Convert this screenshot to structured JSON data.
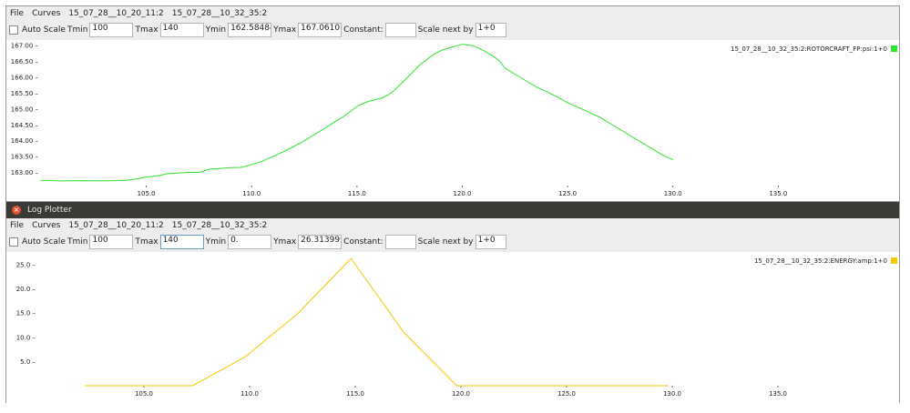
{
  "windows": [
    {
      "title": "",
      "menu": {
        "file": "File",
        "curves": "Curves",
        "sources": [
          "15_07_28__10_20_11:2",
          "15_07_28__10_32_35:2"
        ]
      },
      "toolbar": {
        "autoscale_label": "Auto Scale",
        "autoscale_checked": false,
        "tmin_label": "Tmin",
        "tmin_value": "100",
        "tmax_label": "Tmax",
        "tmax_value": "140",
        "ymin_label": "Ymin",
        "ymin_value": "162.58484",
        "ymax_label": "Ymax",
        "ymax_value": "167.06107",
        "constant_label": "Constant:",
        "constant_value": "",
        "scale_label": "Scale next by",
        "scale_value": "1+0"
      }
    },
    {
      "title": "Log Plotter",
      "menu": {
        "file": "File",
        "curves": "Curves",
        "sources": [
          "15_07_28__10_20_11:2",
          "15_07_28__10_32_35:2"
        ]
      },
      "toolbar": {
        "autoscale_label": "Auto Scale",
        "autoscale_checked": false,
        "tmin_label": "Tmin",
        "tmin_value": "100",
        "tmax_label": "Tmax",
        "tmax_value": "140",
        "ymin_label": "Ymin",
        "ymin_value": "0.",
        "ymax_label": "Ymax",
        "ymax_value": "26.313999",
        "constant_label": "Constant:",
        "constant_value": "",
        "scale_label": "Scale next by",
        "scale_value": "1+0"
      }
    }
  ],
  "chart_data": [
    {
      "type": "line",
      "xlim": [
        100,
        140
      ],
      "ylim": [
        162.58484,
        167.06107
      ],
      "xticks": [
        105.0,
        110.0,
        115.0,
        120.0,
        125.0,
        130.0,
        135.0
      ],
      "xtick_labels": [
        "105.0",
        "110.0",
        "115.0",
        "120.0",
        "125.0",
        "130.0",
        "135.0"
      ],
      "yticks": [
        163.0,
        163.5,
        164.0,
        164.5,
        165.0,
        165.5,
        166.0,
        166.5,
        167.0
      ],
      "ytick_labels": [
        "163.00 –",
        "163.50 –",
        "164.00 –",
        "164.50 –",
        "165.00 –",
        "165.50 –",
        "166.00 –",
        "166.50 –",
        "167.00 –"
      ],
      "series": [
        {
          "name": "15_07_28__10_32_35:2:ROTORCRAFT_FP:psi:1+0",
          "color": "#2ee32e",
          "x": [
            100.0,
            101.0,
            102.0,
            103.0,
            104.0,
            104.6,
            105.0,
            105.6,
            106.0,
            106.5,
            107.0,
            107.5,
            108.0,
            108.5,
            109.0,
            109.5,
            110.0,
            110.5,
            111.0,
            111.5,
            112.0,
            112.5,
            113.0,
            113.5,
            114.0,
            114.5,
            115.0,
            115.3,
            115.6,
            115.9,
            116.2,
            116.5,
            116.8,
            117.1,
            117.4,
            117.7,
            118.0,
            118.3,
            118.6,
            119.0,
            119.5,
            120.0,
            120.5,
            121.0,
            121.5,
            121.8,
            122.0,
            122.5,
            123.0,
            123.5,
            124.0,
            124.5,
            125.0,
            125.5,
            126.0,
            126.5,
            127.0,
            127.5,
            128.0,
            128.5,
            129.0,
            129.5,
            130.0
          ],
          "y": [
            162.75,
            162.73,
            162.74,
            162.73,
            162.75,
            162.8,
            162.85,
            162.9,
            162.96,
            162.98,
            163.0,
            163.0,
            163.1,
            163.12,
            163.15,
            163.16,
            163.25,
            163.35,
            163.5,
            163.65,
            163.82,
            164.0,
            164.2,
            164.4,
            164.62,
            164.82,
            165.08,
            165.18,
            165.25,
            165.3,
            165.35,
            165.45,
            165.6,
            165.8,
            166.0,
            166.2,
            166.4,
            166.55,
            166.7,
            166.85,
            166.95,
            167.04,
            167.0,
            166.85,
            166.65,
            166.5,
            166.3,
            166.1,
            165.9,
            165.7,
            165.55,
            165.38,
            165.2,
            165.05,
            164.9,
            164.75,
            164.55,
            164.35,
            164.15,
            163.95,
            163.75,
            163.55,
            163.4
          ]
        }
      ]
    },
    {
      "type": "line",
      "xlim": [
        100,
        140
      ],
      "ylim": [
        0,
        26.313999
      ],
      "xticks": [
        105.0,
        110.0,
        115.0,
        120.0,
        125.0,
        130.0,
        135.0
      ],
      "xtick_labels": [
        "105.0",
        "110.0",
        "115.0",
        "120.0",
        "125.0",
        "130.0",
        "135.0"
      ],
      "yticks": [
        5.0,
        10.0,
        15.0,
        20.0,
        25.0
      ],
      "ytick_labels": [
        "5.0 –",
        "10.0 –",
        "15.0 –",
        "20.0 –",
        "25.0 –"
      ],
      "series": [
        {
          "name": "15_07_28__10_32_35:2:ENERGY:amp:1+0",
          "color": "#f5c800",
          "x": [
            102.2,
            107.3,
            109.8,
            112.3,
            114.8,
            117.3,
            119.8,
            122.3,
            124.8,
            127.3,
            129.8
          ],
          "y": [
            0.0,
            0.0,
            6.0,
            15.0,
            26.3,
            11.0,
            0.0,
            0.0,
            0.0,
            0.0,
            0.0
          ]
        }
      ]
    }
  ]
}
